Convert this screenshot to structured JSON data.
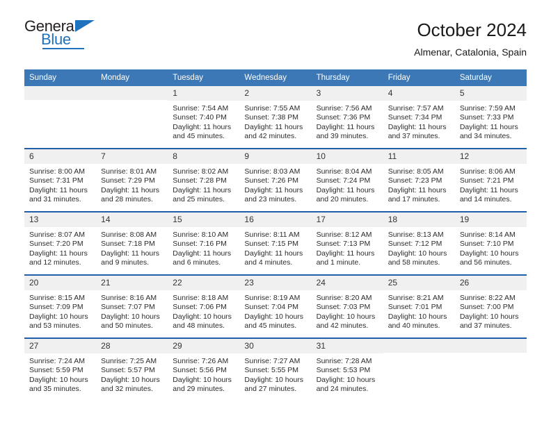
{
  "brand": {
    "name_line1": "General",
    "name_line2": "Blue",
    "icon": "triangle-logo-icon",
    "color_dark": "#231f20",
    "color_blue": "#1f72bd"
  },
  "header": {
    "title": "October 2024",
    "location": "Almenar, Catalonia, Spain"
  },
  "theme": {
    "header_blue": "#3b78b5",
    "row_border_blue": "#1f5fa9",
    "daynum_bg": "#f0f0f0"
  },
  "labels": {
    "sunrise_prefix": "Sunrise:",
    "sunset_prefix": "Sunset:",
    "daylight_prefix": "Daylight:"
  },
  "weekdays": [
    "Sunday",
    "Monday",
    "Tuesday",
    "Wednesday",
    "Thursday",
    "Friday",
    "Saturday"
  ],
  "weeks": [
    [
      {
        "day": "",
        "sunrise": "",
        "sunset": "",
        "daylight": "",
        "empty": true
      },
      {
        "day": "",
        "sunrise": "",
        "sunset": "",
        "daylight": "",
        "empty": true
      },
      {
        "day": "1",
        "sunrise": "Sunrise: 7:54 AM",
        "sunset": "Sunset: 7:40 PM",
        "daylight": "Daylight: 11 hours and 45 minutes."
      },
      {
        "day": "2",
        "sunrise": "Sunrise: 7:55 AM",
        "sunset": "Sunset: 7:38 PM",
        "daylight": "Daylight: 11 hours and 42 minutes."
      },
      {
        "day": "3",
        "sunrise": "Sunrise: 7:56 AM",
        "sunset": "Sunset: 7:36 PM",
        "daylight": "Daylight: 11 hours and 39 minutes."
      },
      {
        "day": "4",
        "sunrise": "Sunrise: 7:57 AM",
        "sunset": "Sunset: 7:34 PM",
        "daylight": "Daylight: 11 hours and 37 minutes."
      },
      {
        "day": "5",
        "sunrise": "Sunrise: 7:59 AM",
        "sunset": "Sunset: 7:33 PM",
        "daylight": "Daylight: 11 hours and 34 minutes."
      }
    ],
    [
      {
        "day": "6",
        "sunrise": "Sunrise: 8:00 AM",
        "sunset": "Sunset: 7:31 PM",
        "daylight": "Daylight: 11 hours and 31 minutes."
      },
      {
        "day": "7",
        "sunrise": "Sunrise: 8:01 AM",
        "sunset": "Sunset: 7:29 PM",
        "daylight": "Daylight: 11 hours and 28 minutes."
      },
      {
        "day": "8",
        "sunrise": "Sunrise: 8:02 AM",
        "sunset": "Sunset: 7:28 PM",
        "daylight": "Daylight: 11 hours and 25 minutes."
      },
      {
        "day": "9",
        "sunrise": "Sunrise: 8:03 AM",
        "sunset": "Sunset: 7:26 PM",
        "daylight": "Daylight: 11 hours and 23 minutes."
      },
      {
        "day": "10",
        "sunrise": "Sunrise: 8:04 AM",
        "sunset": "Sunset: 7:24 PM",
        "daylight": "Daylight: 11 hours and 20 minutes."
      },
      {
        "day": "11",
        "sunrise": "Sunrise: 8:05 AM",
        "sunset": "Sunset: 7:23 PM",
        "daylight": "Daylight: 11 hours and 17 minutes."
      },
      {
        "day": "12",
        "sunrise": "Sunrise: 8:06 AM",
        "sunset": "Sunset: 7:21 PM",
        "daylight": "Daylight: 11 hours and 14 minutes."
      }
    ],
    [
      {
        "day": "13",
        "sunrise": "Sunrise: 8:07 AM",
        "sunset": "Sunset: 7:20 PM",
        "daylight": "Daylight: 11 hours and 12 minutes."
      },
      {
        "day": "14",
        "sunrise": "Sunrise: 8:08 AM",
        "sunset": "Sunset: 7:18 PM",
        "daylight": "Daylight: 11 hours and 9 minutes."
      },
      {
        "day": "15",
        "sunrise": "Sunrise: 8:10 AM",
        "sunset": "Sunset: 7:16 PM",
        "daylight": "Daylight: 11 hours and 6 minutes."
      },
      {
        "day": "16",
        "sunrise": "Sunrise: 8:11 AM",
        "sunset": "Sunset: 7:15 PM",
        "daylight": "Daylight: 11 hours and 4 minutes."
      },
      {
        "day": "17",
        "sunrise": "Sunrise: 8:12 AM",
        "sunset": "Sunset: 7:13 PM",
        "daylight": "Daylight: 11 hours and 1 minute."
      },
      {
        "day": "18",
        "sunrise": "Sunrise: 8:13 AM",
        "sunset": "Sunset: 7:12 PM",
        "daylight": "Daylight: 10 hours and 58 minutes."
      },
      {
        "day": "19",
        "sunrise": "Sunrise: 8:14 AM",
        "sunset": "Sunset: 7:10 PM",
        "daylight": "Daylight: 10 hours and 56 minutes."
      }
    ],
    [
      {
        "day": "20",
        "sunrise": "Sunrise: 8:15 AM",
        "sunset": "Sunset: 7:09 PM",
        "daylight": "Daylight: 10 hours and 53 minutes."
      },
      {
        "day": "21",
        "sunrise": "Sunrise: 8:16 AM",
        "sunset": "Sunset: 7:07 PM",
        "daylight": "Daylight: 10 hours and 50 minutes."
      },
      {
        "day": "22",
        "sunrise": "Sunrise: 8:18 AM",
        "sunset": "Sunset: 7:06 PM",
        "daylight": "Daylight: 10 hours and 48 minutes."
      },
      {
        "day": "23",
        "sunrise": "Sunrise: 8:19 AM",
        "sunset": "Sunset: 7:04 PM",
        "daylight": "Daylight: 10 hours and 45 minutes."
      },
      {
        "day": "24",
        "sunrise": "Sunrise: 8:20 AM",
        "sunset": "Sunset: 7:03 PM",
        "daylight": "Daylight: 10 hours and 42 minutes."
      },
      {
        "day": "25",
        "sunrise": "Sunrise: 8:21 AM",
        "sunset": "Sunset: 7:01 PM",
        "daylight": "Daylight: 10 hours and 40 minutes."
      },
      {
        "day": "26",
        "sunrise": "Sunrise: 8:22 AM",
        "sunset": "Sunset: 7:00 PM",
        "daylight": "Daylight: 10 hours and 37 minutes."
      }
    ],
    [
      {
        "day": "27",
        "sunrise": "Sunrise: 7:24 AM",
        "sunset": "Sunset: 5:59 PM",
        "daylight": "Daylight: 10 hours and 35 minutes."
      },
      {
        "day": "28",
        "sunrise": "Sunrise: 7:25 AM",
        "sunset": "Sunset: 5:57 PM",
        "daylight": "Daylight: 10 hours and 32 minutes."
      },
      {
        "day": "29",
        "sunrise": "Sunrise: 7:26 AM",
        "sunset": "Sunset: 5:56 PM",
        "daylight": "Daylight: 10 hours and 29 minutes."
      },
      {
        "day": "30",
        "sunrise": "Sunrise: 7:27 AM",
        "sunset": "Sunset: 5:55 PM",
        "daylight": "Daylight: 10 hours and 27 minutes."
      },
      {
        "day": "31",
        "sunrise": "Sunrise: 7:28 AM",
        "sunset": "Sunset: 5:53 PM",
        "daylight": "Daylight: 10 hours and 24 minutes."
      },
      {
        "day": "",
        "sunrise": "",
        "sunset": "",
        "daylight": "",
        "empty": true
      },
      {
        "day": "",
        "sunrise": "",
        "sunset": "",
        "daylight": "",
        "empty": true
      }
    ]
  ]
}
